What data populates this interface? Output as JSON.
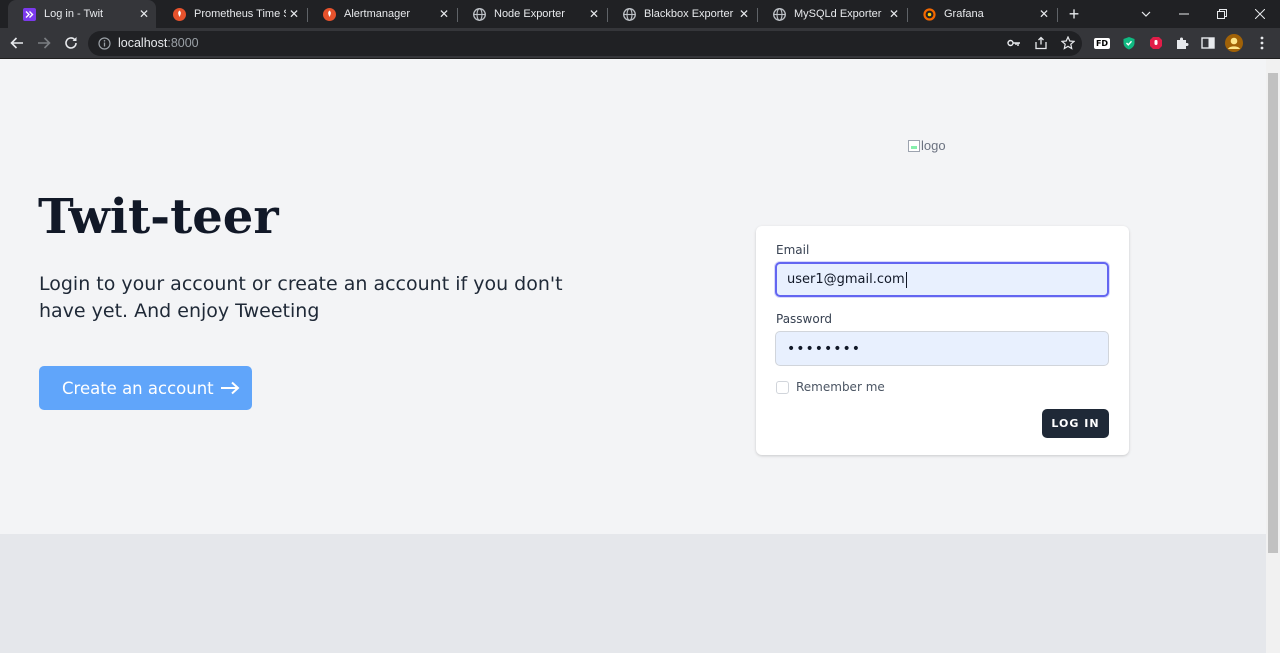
{
  "browser": {
    "tabs": [
      {
        "title": "Log in - Twit",
        "icon": "twit-icon",
        "active": true
      },
      {
        "title": "Prometheus Time Ser",
        "icon": "prometheus-icon",
        "active": false
      },
      {
        "title": "Alertmanager",
        "icon": "prometheus-icon",
        "active": false
      },
      {
        "title": "Node Exporter",
        "icon": "globe-icon",
        "active": false
      },
      {
        "title": "Blackbox Exporter",
        "icon": "globe-icon",
        "active": false
      },
      {
        "title": "MySQLd Exporter",
        "icon": "globe-icon",
        "active": false
      },
      {
        "title": "Grafana",
        "icon": "grafana-icon",
        "active": false
      }
    ],
    "new_tab": "+",
    "close_glyph": "✕",
    "address": {
      "host": "localhost",
      "port": ":8000"
    },
    "extension_fd": "FD"
  },
  "hero": {
    "brand": "Twit-teer",
    "tagline": "Login to your account or create an account if you don't have yet. And enjoy Tweeting",
    "cta_label": "Create an account"
  },
  "logo": {
    "alt": "logo"
  },
  "login_form": {
    "email_label": "Email",
    "email_value": "user1@gmail.com",
    "password_label": "Password",
    "password_value": "••••••••",
    "remember_label": "Remember me",
    "remember_checked": false,
    "submit_label": "LOG IN"
  },
  "colors": {
    "cta_bg": "#60a5fa",
    "button_dark": "#1f2937",
    "focus_ring": "#6366f1",
    "input_autofill": "#e8f0fe"
  }
}
